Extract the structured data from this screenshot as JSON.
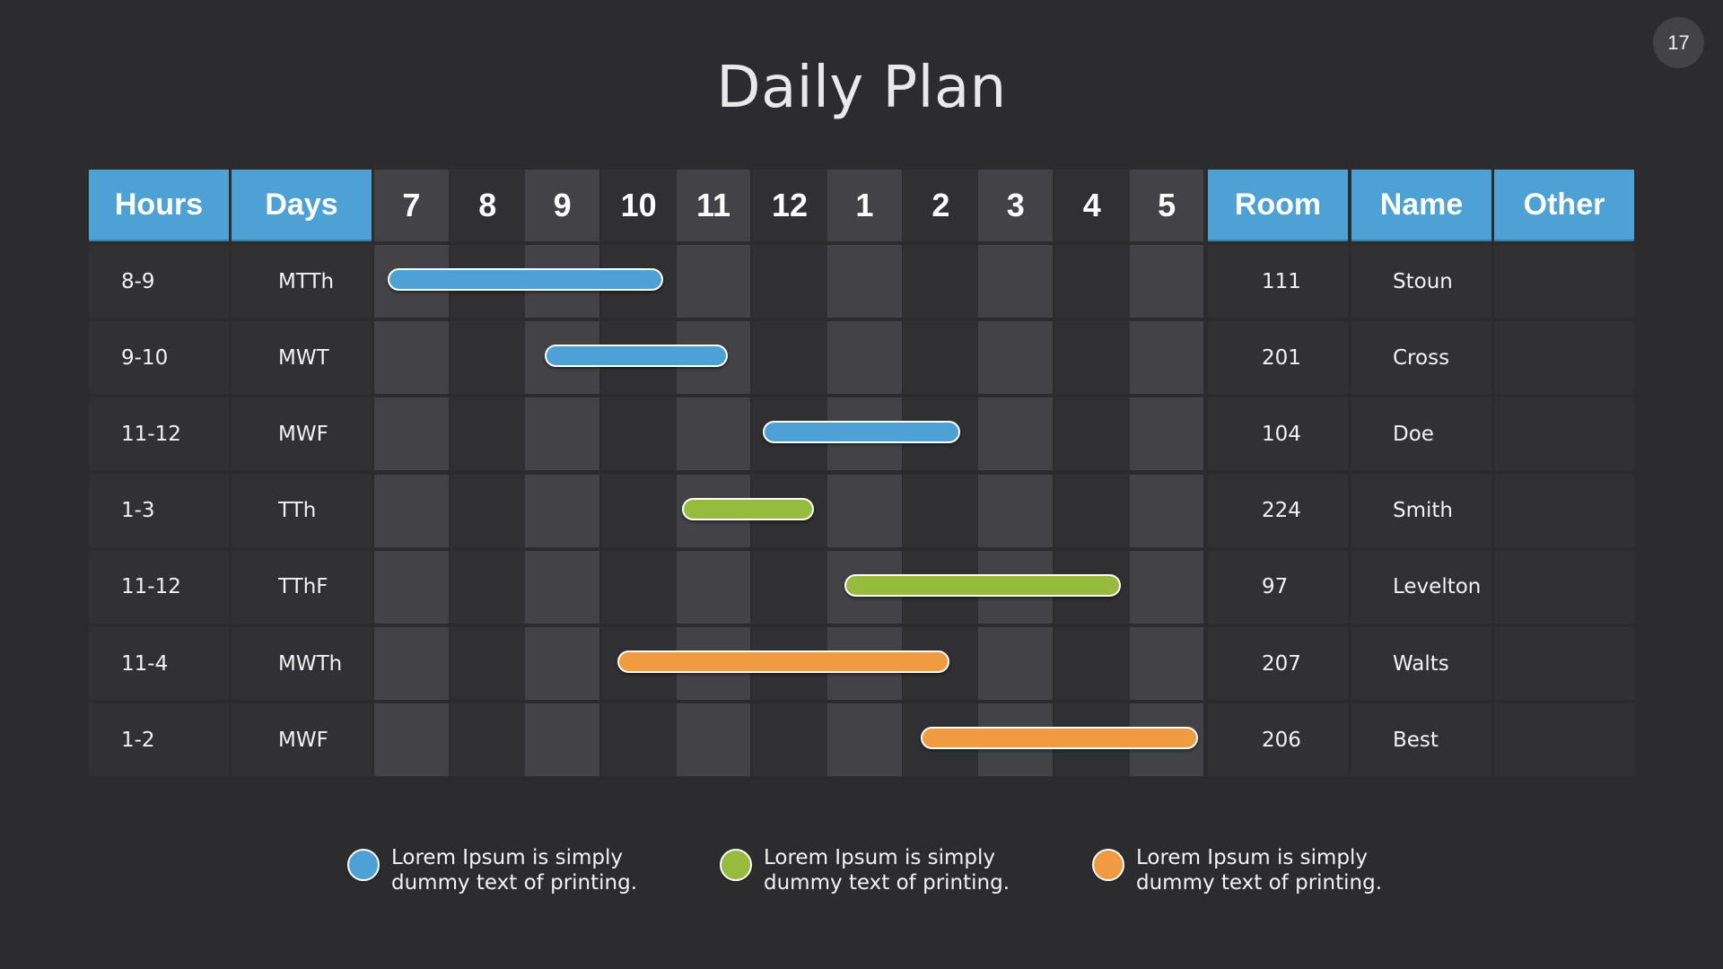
{
  "page": {
    "title": "Daily Plan",
    "page_number": "17"
  },
  "colors": {
    "blue": "#4ea1d4",
    "green": "#97bb3c",
    "orange": "#f09a41"
  },
  "headers": {
    "hours": "Hours",
    "days": "Days",
    "room": "Room",
    "name": "Name",
    "other": "Other"
  },
  "chart_data": {
    "type": "gantt",
    "title": "Daily Plan",
    "time_axis": {
      "tick_labels": [
        "7",
        "8",
        "9",
        "10",
        "11",
        "12",
        "1",
        "2",
        "3",
        "4",
        "5"
      ],
      "range_hours_24h": [
        7,
        18
      ]
    },
    "columns": [
      "Hours",
      "Days",
      "Room",
      "Name",
      "Other"
    ],
    "rows": [
      {
        "hours": "8-9",
        "days": "MTTh",
        "room": "111",
        "name": "Stoun",
        "other": "",
        "color": "blue",
        "start": 7.18,
        "end": 10.82
      },
      {
        "hours": "9-10",
        "days": "MWT",
        "room": "201",
        "name": "Cross",
        "other": "",
        "color": "blue",
        "start": 9.26,
        "end": 11.68
      },
      {
        "hours": "11-12",
        "days": "MWF",
        "room": "104",
        "name": "Doe",
        "other": "",
        "color": "blue",
        "start": 12.14,
        "end": 14.76
      },
      {
        "hours": "1-3",
        "days": "TTh",
        "room": "224",
        "name": "Smith",
        "other": "",
        "color": "green",
        "start": 11.07,
        "end": 12.82
      },
      {
        "hours": "11-12",
        "days": "TThF",
        "room": "97",
        "name": "Levelton",
        "other": "",
        "color": "green",
        "start": 13.23,
        "end": 16.88
      },
      {
        "hours": "11-4",
        "days": "MWTh",
        "room": "207",
        "name": "Walts",
        "other": "",
        "color": "orange",
        "start": 10.22,
        "end": 14.62
      },
      {
        "hours": "1-2",
        "days": "MWF",
        "room": "206",
        "name": "Best",
        "other": "",
        "color": "orange",
        "start": 14.24,
        "end": 17.9
      }
    ],
    "legend": [
      {
        "color": "blue",
        "line1": "Lorem Ipsum is simply",
        "line2": "dummy text of printing."
      },
      {
        "color": "green",
        "line1": "Lorem Ipsum is simply",
        "line2": "dummy text of printing."
      },
      {
        "color": "orange",
        "line1": "Lorem Ipsum is simply",
        "line2": "dummy text of printing."
      }
    ]
  }
}
